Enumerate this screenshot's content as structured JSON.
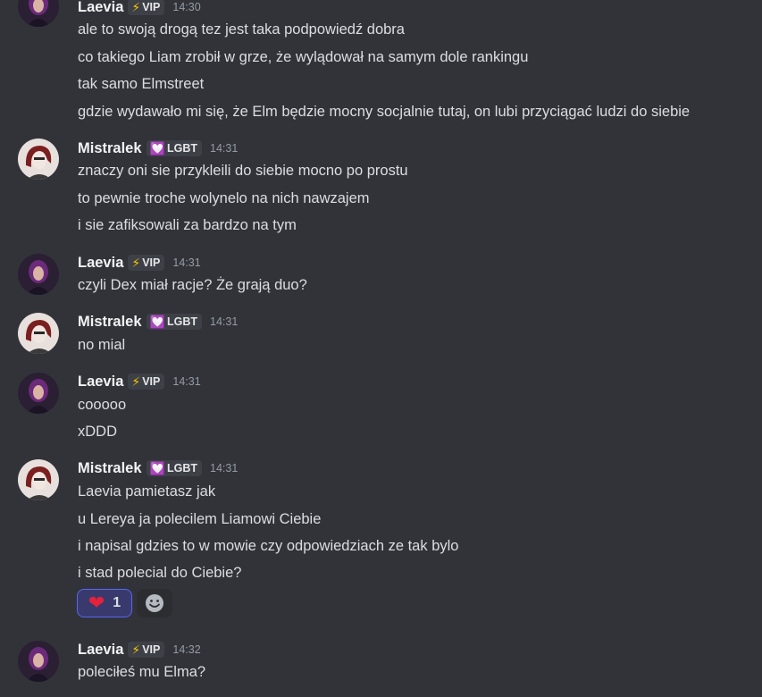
{
  "users": {
    "laevia": {
      "name": "Laevia",
      "tag": "VIP",
      "tag_icon": "lightning-icon",
      "tag_color": "#f5c400"
    },
    "mistralek": {
      "name": "Mistralek",
      "tag": "LGBT",
      "tag_icon": "heart-icon",
      "tag_color": "#ff7ad9"
    }
  },
  "messages": [
    {
      "author": "Laevia",
      "tag": "VIP",
      "time": "14:30",
      "lines": [
        "ale to swoją drogą tez jest taka podpowiedź dobra",
        "co takiego Liam zrobił w grze, że wylądował na samym dole rankingu",
        "tak samo Elmstreet",
        "gdzie wydawało mi się, że Elm będzie mocny socjalnie tutaj, on lubi przyciągać ludzi do siebie"
      ]
    },
    {
      "author": "Mistralek",
      "tag": "LGBT",
      "time": "14:31",
      "lines": [
        "znaczy oni sie przykleili do siebie mocno po prostu",
        "to pewnie troche wolynelo na nich nawzajem",
        "i sie zafiksowali za bardzo na tym"
      ]
    },
    {
      "author": "Laevia",
      "tag": "VIP",
      "time": "14:31",
      "lines": [
        "czyli Dex miał racje? Że grają duo?"
      ]
    },
    {
      "author": "Mistralek",
      "tag": "LGBT",
      "time": "14:31",
      "lines": [
        "no mial"
      ]
    },
    {
      "author": "Laevia",
      "tag": "VIP",
      "time": "14:31",
      "lines": [
        "cooooo",
        "xDDD"
      ]
    },
    {
      "author": "Mistralek",
      "tag": "LGBT",
      "time": "14:31",
      "lines": [
        "Laevia pamietasz jak",
        "u Lereya ja polecilem Liamowi Ciebie",
        "i napisal gdzies to w mowie czy odpowiedziach ze tak bylo",
        "i stad polecial do Ciebie?"
      ],
      "reactions": [
        {
          "emoji": "heart-emoji",
          "count": "1",
          "active": true
        }
      ]
    },
    {
      "author": "Laevia",
      "tag": "VIP",
      "time": "14:32",
      "lines": [
        "poleciłeś mu Elma?"
      ]
    }
  ],
  "colors": {
    "background": "#323339",
    "reaction_active_border": "#5865f2",
    "reaction_active_bg": "#383a6e"
  }
}
